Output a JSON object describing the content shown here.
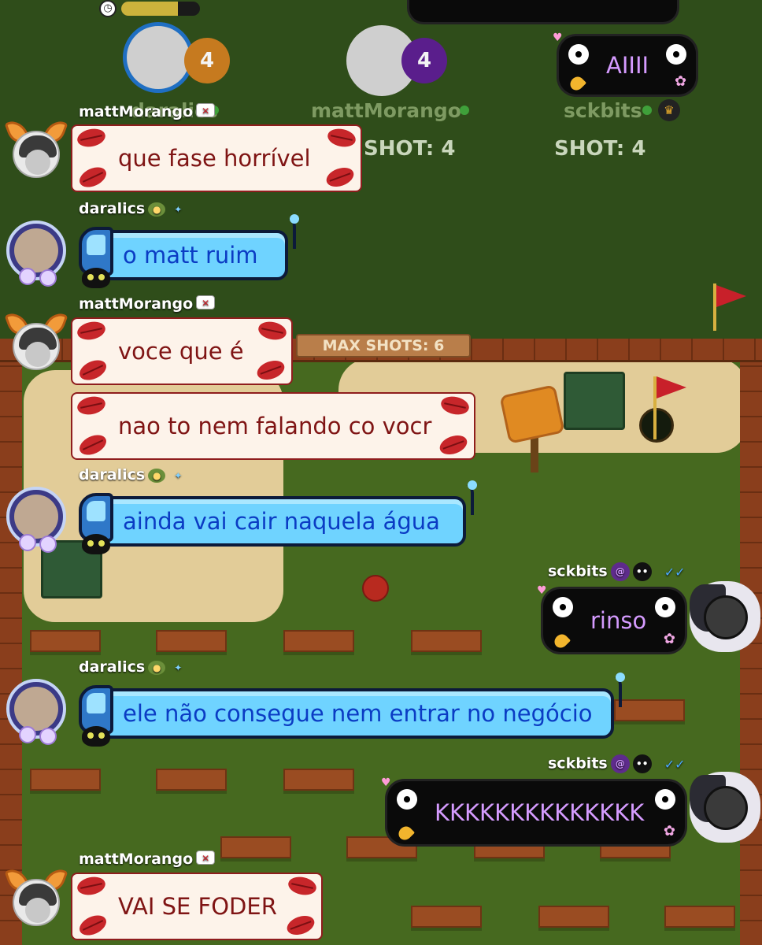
{
  "game": {
    "max_shots_label": "MAX SHOTS: 6",
    "timer": {
      "icon": "clock-icon",
      "progress": 0.72
    }
  },
  "players": [
    {
      "name": "daralics",
      "score": "4",
      "shot": "",
      "score_color": "#c67a1f"
    },
    {
      "name": "mattMorango",
      "score": "4",
      "shot": "SHOT: 4",
      "score_color": "#5a1e8c"
    },
    {
      "name": "sckbits",
      "score": "",
      "shot": "SHOT: 4",
      "status_bubble": "AIIII"
    }
  ],
  "top_bubble_partial": "",
  "messages": [
    {
      "user": "mattMorango",
      "style": "kiss",
      "text": "que fase horrível"
    },
    {
      "user": "daralics",
      "style": "bus",
      "text": "o matt ruim"
    },
    {
      "user": "mattMorango",
      "style": "kiss",
      "text": "voce que é"
    },
    {
      "user": "mattMorango",
      "style": "kiss",
      "text": "nao to nem falando co vocr"
    },
    {
      "user": "daralics",
      "style": "bus",
      "text": "ainda vai cair naquela água"
    },
    {
      "user": "sckbits",
      "style": "soot",
      "text": "rinso"
    },
    {
      "user": "daralics",
      "style": "bus",
      "text": "ele não consegue nem entrar no negócio"
    },
    {
      "user": "sckbits",
      "style": "soot",
      "text": "KKKKKKKKKKKKKK"
    },
    {
      "user": "mattMorango",
      "style": "kiss",
      "text": "VAI SE FODER"
    }
  ],
  "usernames": {
    "matt": "mattMorango",
    "dara": "daralics",
    "sck": "sckbits"
  },
  "colors": {
    "kiss_text": "#7f1414",
    "bus_text": "#0b3cc4",
    "soot_text": "#d59bff",
    "field": "#46691f"
  }
}
